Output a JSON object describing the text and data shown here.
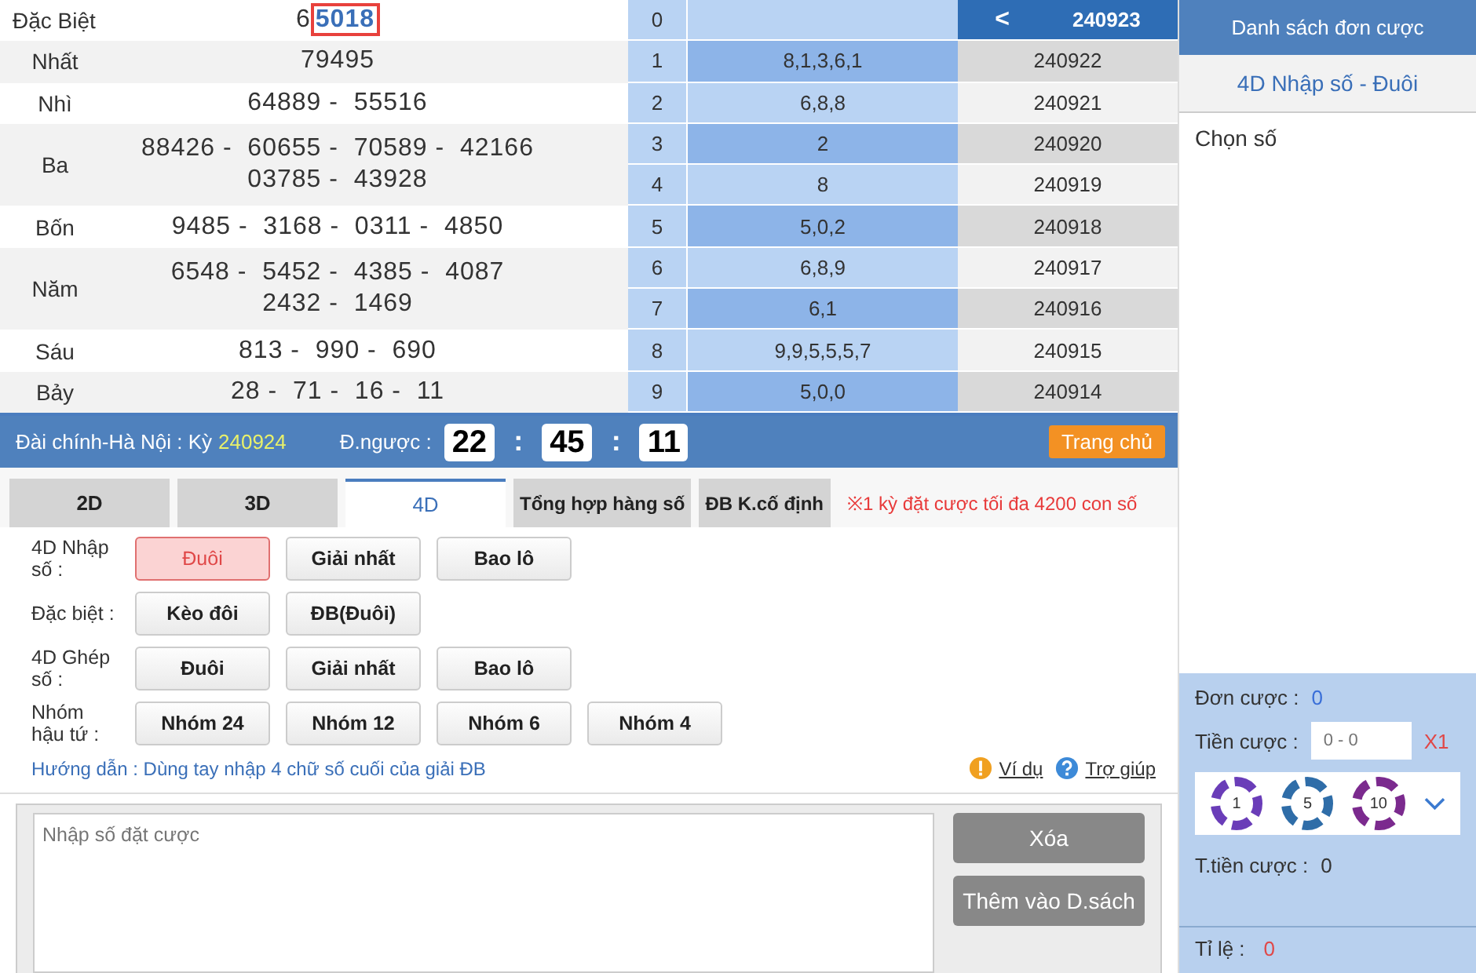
{
  "results": [
    {
      "label": "Đặc Biệt",
      "lines": [
        "6**5018**"
      ]
    },
    {
      "label": "Nhất",
      "lines": [
        "79495"
      ]
    },
    {
      "label": "Nhì",
      "lines": [
        "64889 -  55516"
      ]
    },
    {
      "label": "Ba",
      "lines": [
        "88426 -  60655 -  70589 -  42166",
        "03785 -  43928"
      ]
    },
    {
      "label": "Bốn",
      "lines": [
        "9485 -  3168 -  0311 -  4850"
      ]
    },
    {
      "label": "Năm",
      "lines": [
        "6548 -  5452 -  4385 -  4087",
        "2432 -  1469"
      ]
    },
    {
      "label": "Sáu",
      "lines": [
        "813 -  990 -  690"
      ]
    },
    {
      "label": "Bảy",
      "lines": [
        "28 -  71 -  16 -  11"
      ]
    }
  ],
  "tail_table": [
    {
      "digit": "0",
      "period": "240923",
      "current": true
    },
    {
      "digit": "1",
      "values": "8,1,3,6,1",
      "period": "240922",
      "current": false
    },
    {
      "digit": "2",
      "values": "6,8,8",
      "period": "240921",
      "current": false
    },
    {
      "digit": "3",
      "values": "2",
      "period": "240920",
      "current": false
    },
    {
      "digit": "4",
      "values": "8",
      "period": "240919",
      "current": false
    },
    {
      "digit": "5",
      "values": "5,0,2",
      "period": "240918",
      "current": false
    },
    {
      "digit": "6",
      "values": "6,8,9",
      "period": "240917",
      "current": false
    },
    {
      "digit": "7",
      "values": "6,1",
      "period": "240916",
      "current": false
    },
    {
      "digit": "8",
      "values": "9,9,5,5,5,7",
      "period": "240915",
      "current": false
    },
    {
      "digit": "9",
      "values": "5,0,0",
      "period": "240914",
      "current": false
    }
  ],
  "prev_icon": "<",
  "info_bar": {
    "station": "Đài chính-Hà Nội  :  Kỳ",
    "period": "240924",
    "countdown_label": "Đ.ngược :",
    "countdown": [
      "22",
      "45",
      "11"
    ],
    "separator": ":",
    "home": "Trang chủ"
  },
  "tabs": [
    {
      "label": "2D",
      "selected": false
    },
    {
      "label": "3D",
      "selected": false
    },
    {
      "label": "4D",
      "selected": true
    },
    {
      "label": "Tổng hợp hàng số",
      "selected": false
    },
    {
      "label": "ĐB K.cố định",
      "selected": false
    }
  ],
  "notice": "※1 kỳ đặt cược tối đa 4200 con số",
  "options": [
    {
      "label": "4D Nhập số :",
      "buttons": [
        {
          "label": "Đuôi",
          "selected": true
        },
        {
          "label": "Giải nhất",
          "selected": false
        },
        {
          "label": "Bao lô",
          "selected": false
        }
      ]
    },
    {
      "label": "Đặc biệt :",
      "buttons": [
        {
          "label": "Kèo đôi",
          "selected": false
        },
        {
          "label": "ĐB(Đuôi)",
          "selected": false
        }
      ]
    },
    {
      "label": "4D Ghép số :",
      "buttons": [
        {
          "label": "Đuôi",
          "selected": false
        },
        {
          "label": "Giải nhất",
          "selected": false
        },
        {
          "label": "Bao lô",
          "selected": false
        }
      ]
    },
    {
      "label": "Nhóm hậu tứ :",
      "buttons": [
        {
          "label": "Nhóm 24",
          "selected": false
        },
        {
          "label": "Nhóm 12",
          "selected": false
        },
        {
          "label": "Nhóm 6",
          "selected": false
        },
        {
          "label": "Nhóm 4",
          "selected": false
        }
      ]
    }
  ],
  "guide": "Hướng dẫn : Dùng tay nhập 4 chữ số cuối của giải ĐB",
  "example_link": "Ví dụ",
  "help_link": "Trợ giúp",
  "entry": {
    "placeholder": "Nhập số đặt cược"
  },
  "actions": [
    "Xóa",
    "Thêm vào D.sách"
  ],
  "sidebar": {
    "header": "Danh sách đơn cược",
    "mode": "4D Nhập số - Đuôi",
    "pick_label": "Chọn số",
    "orders_label": "Đơn cược :",
    "orders": "0",
    "stake_label": "Tiền cược :",
    "stake_placeholder": "0 - 0",
    "multiplier": "X1",
    "chips": [
      {
        "label": "1",
        "color": "#6a3db8"
      },
      {
        "label": "5",
        "color": "#2f6da8"
      },
      {
        "label": "10",
        "color": "#7b2a8e"
      }
    ],
    "total_label": "T.tiền cược :",
    "total": "0",
    "ratio_label": "Tỉ lệ :",
    "ratio": "0"
  }
}
